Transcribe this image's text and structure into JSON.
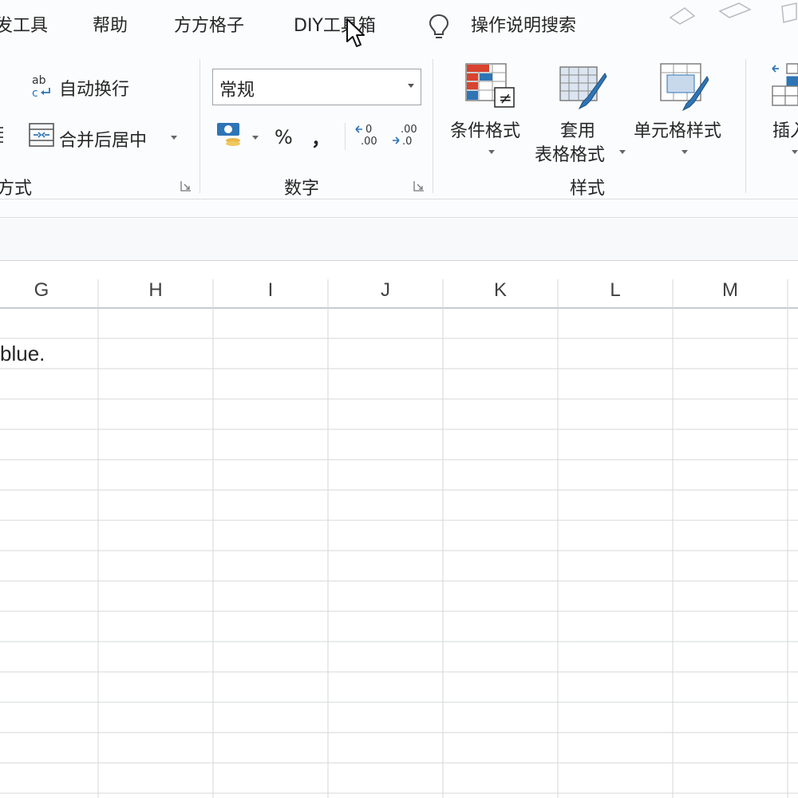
{
  "tabs": [
    {
      "label": "发工具"
    },
    {
      "label": "帮助"
    },
    {
      "label": "方方格子"
    },
    {
      "label": "DIY工具箱"
    },
    {
      "label": "操作说明搜索"
    }
  ],
  "alignment_group": {
    "wrap_text_label": "自动换行",
    "merge_center_label": "合并后居中",
    "group_label": "方式"
  },
  "number_group": {
    "format_value": "常规",
    "percent_symbol": "%",
    "comma_symbol": "，",
    "group_label": "数字"
  },
  "styles_group": {
    "conditional_format_label": "条件格式",
    "table_format_line1": "套用",
    "table_format_line2": "表格格式",
    "cell_styles_label": "单元格样式",
    "group_label": "样式"
  },
  "cells_group": {
    "insert_label": "插入"
  },
  "grid": {
    "columns": [
      "G",
      "H",
      "I",
      "J",
      "K",
      "L",
      "M"
    ],
    "cell_text": "blue."
  },
  "colors": {
    "accent_blue": "#2e75b6",
    "accent_red": "#d9432f",
    "grid_line": "#d4d7da"
  }
}
